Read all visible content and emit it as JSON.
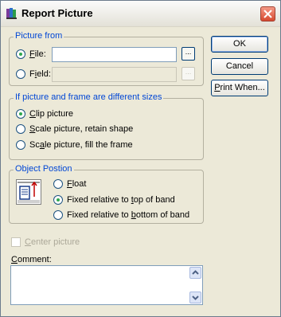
{
  "window": {
    "title": "Report Picture"
  },
  "picture_from": {
    "legend": "Picture from",
    "file_label": "File:",
    "field_label": "Field:",
    "file_value": "",
    "field_value": "",
    "browse_glyph": "...",
    "selected": "file"
  },
  "size_group": {
    "legend": "If picture and frame are different sizes",
    "options": [
      "Clip picture",
      "Scale picture, retain shape",
      "Scale picture, fill the frame"
    ],
    "selected": "Clip picture"
  },
  "position_group": {
    "legend": "Object Postion",
    "options": [
      "Float",
      "Fixed relative to top of band",
      "Fixed relative to bottom of band"
    ],
    "selected": "Fixed relative to top of band",
    "icon": "object-position-icon"
  },
  "center_picture": {
    "label": "Center picture",
    "checked": false,
    "disabled": true
  },
  "comment": {
    "label": "Comment:",
    "value": ""
  },
  "buttons": {
    "ok": "OK",
    "cancel": "Cancel",
    "print_when": "Print When..."
  },
  "colors": {
    "legend": "#0046d5",
    "dialog_bg": "#ece9d8",
    "close_red": "#d6492f",
    "radio_green": "#2fa84f"
  }
}
